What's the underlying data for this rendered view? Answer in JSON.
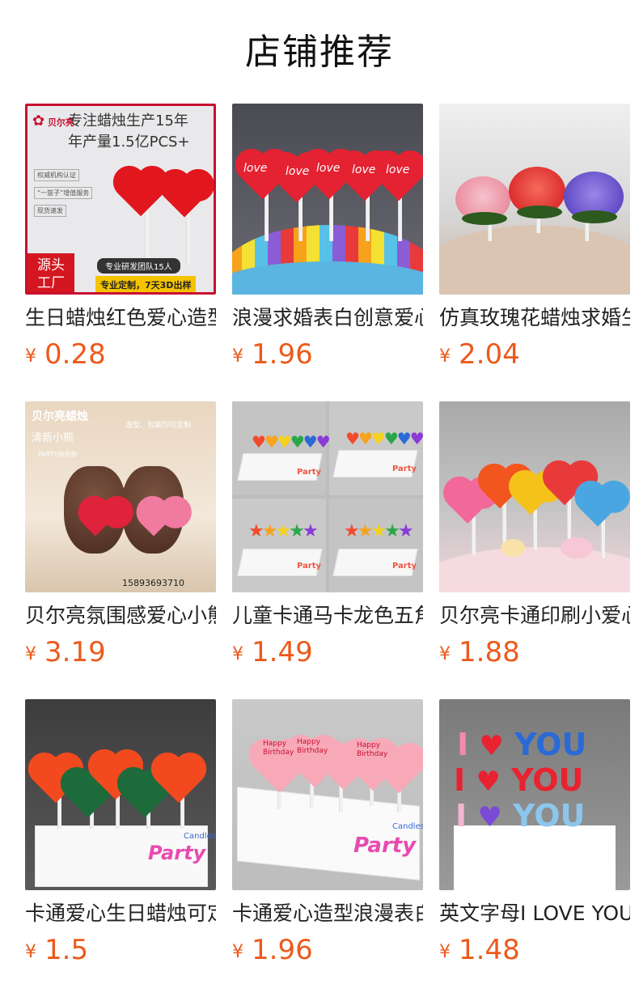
{
  "header": {
    "title": "店铺推荐"
  },
  "products": [
    {
      "name": "生日蜡烛红色爱心造型",
      "price": "0.28",
      "currency": "¥",
      "image": {
        "line1": "专注蜡烛生产15年",
        "line2": "年产量1.5亿PCS+",
        "brand": "贝尔亮",
        "badges": [
          "权威机构认证",
          "“一篮子”增值服务",
          "现货速发"
        ],
        "team": "专业研发团队15人",
        "custom": "专业定制，7天3D出样",
        "corner": [
          "源头",
          "工厂"
        ]
      }
    },
    {
      "name": "浪漫求婚表白创意爱心蜡烛",
      "price": "1.96",
      "currency": "¥",
      "image": {
        "heart_text": "love"
      }
    },
    {
      "name": "仿真玫瑰花蜡烛求婚生日",
      "price": "2.04",
      "currency": "¥"
    },
    {
      "name": "贝尔亮氛围感爱心小熊蜡烛",
      "price": "3.19",
      "currency": "¥",
      "image": {
        "brand": "贝尔亮蜡烛",
        "sub": "清新小熊",
        "tag": "PARTY快乐你",
        "note": "造型、包装均可定制",
        "phone": "15893693710"
      }
    },
    {
      "name": "儿童卡通马卡龙色五角星蜡烛",
      "price": "1.49",
      "currency": "¥",
      "image": {
        "box_text": "Party"
      }
    },
    {
      "name": "贝尔亮卡通印刷小爱心蜡烛",
      "price": "1.88",
      "currency": "¥"
    },
    {
      "name": "卡通爱心生日蜡烛可定制",
      "price": "1.5",
      "currency": "¥",
      "image": {
        "box_text": "Party",
        "box_sub": "Candles"
      }
    },
    {
      "name": "卡通爱心造型浪漫表白蜡烛",
      "price": "1.96",
      "currency": "¥",
      "image": {
        "heart_text": "Happy Birthday",
        "box_text": "Party",
        "box_sub": "Candles"
      }
    },
    {
      "name": "英文字母I LOVE YOU蜡烛",
      "price": "1.48",
      "currency": "¥",
      "image": {
        "letters": [
          "I",
          "YOU",
          "I",
          "YOU",
          "I",
          "YOU"
        ]
      }
    }
  ],
  "colors": {
    "price": "#ec5a1c",
    "title": "#111111"
  }
}
